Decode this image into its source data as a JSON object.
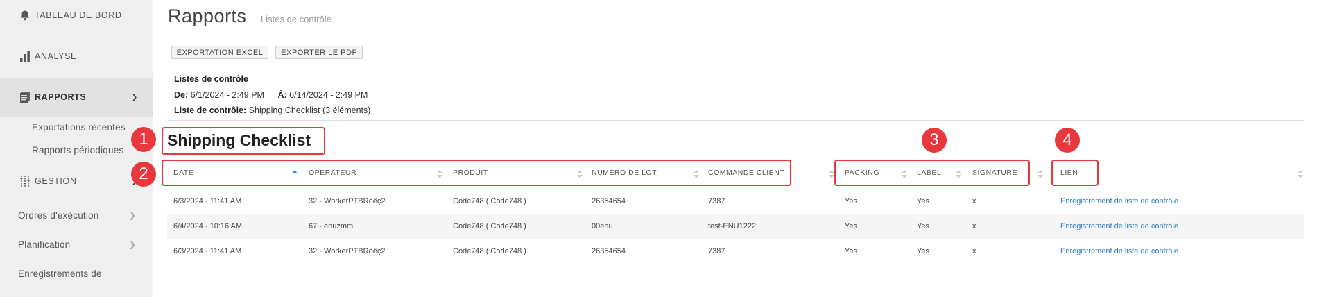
{
  "sidebar": {
    "dashboard": "TABLEAU DE BORD",
    "analysis": "ANALYSE",
    "reports": "RAPPORTS",
    "reports_sub": [
      "Exportations récentes",
      "Rapports périodiques"
    ],
    "management": "GESTION",
    "items": [
      "Ordres d'exécution",
      "Planification",
      "Enregistrements de"
    ]
  },
  "header": {
    "title": "Rapports",
    "subtitle": "Listes de contrôle",
    "export_excel": "EXPORTATION EXCEL",
    "export_pdf": "EXPORTER LE PDF"
  },
  "info": {
    "heading": "Listes de contrôle",
    "from_label": "De:",
    "from_value": "6/1/2024 - 2:49 PM",
    "to_label": "À:",
    "to_value": "6/14/2024 - 2:49 PM",
    "checklist_label": "Liste de contrôle:",
    "checklist_value": "Shipping Checklist (3 éléments)"
  },
  "checklist_title": "Shipping Checklist",
  "table": {
    "columns": [
      "DATE",
      "OPÉRATEUR",
      "PRODUIT",
      "NUMÉRO DE LOT",
      "COMMANDE CLIENT",
      "PACKING",
      "LABEL",
      "SIGNATURE",
      "LIEN"
    ],
    "rows": [
      [
        "6/3/2024 - 11:41 AM",
        "32 - WorkerPTBRõêç2",
        "Code748 ( Code748 )",
        "26354654",
        "7387",
        "Yes",
        "Yes",
        "x",
        "Enregistrement de liste de contrôle"
      ],
      [
        "6/4/2024 - 10:16 AM",
        "67 - enuzmm",
        "Code748 ( Code748 )",
        "00enu",
        "test-ENU1222",
        "Yes",
        "Yes",
        "x",
        "Enregistrement de liste de contrôle"
      ],
      [
        "6/3/2024 - 11:41 AM",
        "32 - WorkerPTBRõêç2",
        "Code748 ( Code748 )",
        "26354654",
        "7387",
        "Yes",
        "Yes",
        "x",
        "Enregistrement de liste de contrôle"
      ]
    ]
  },
  "annotations": [
    "1",
    "2",
    "3",
    "4"
  ],
  "colors": {
    "annotation": "#e8383d",
    "link": "#2e7fc1",
    "sort_active": "#2a8fd6"
  }
}
